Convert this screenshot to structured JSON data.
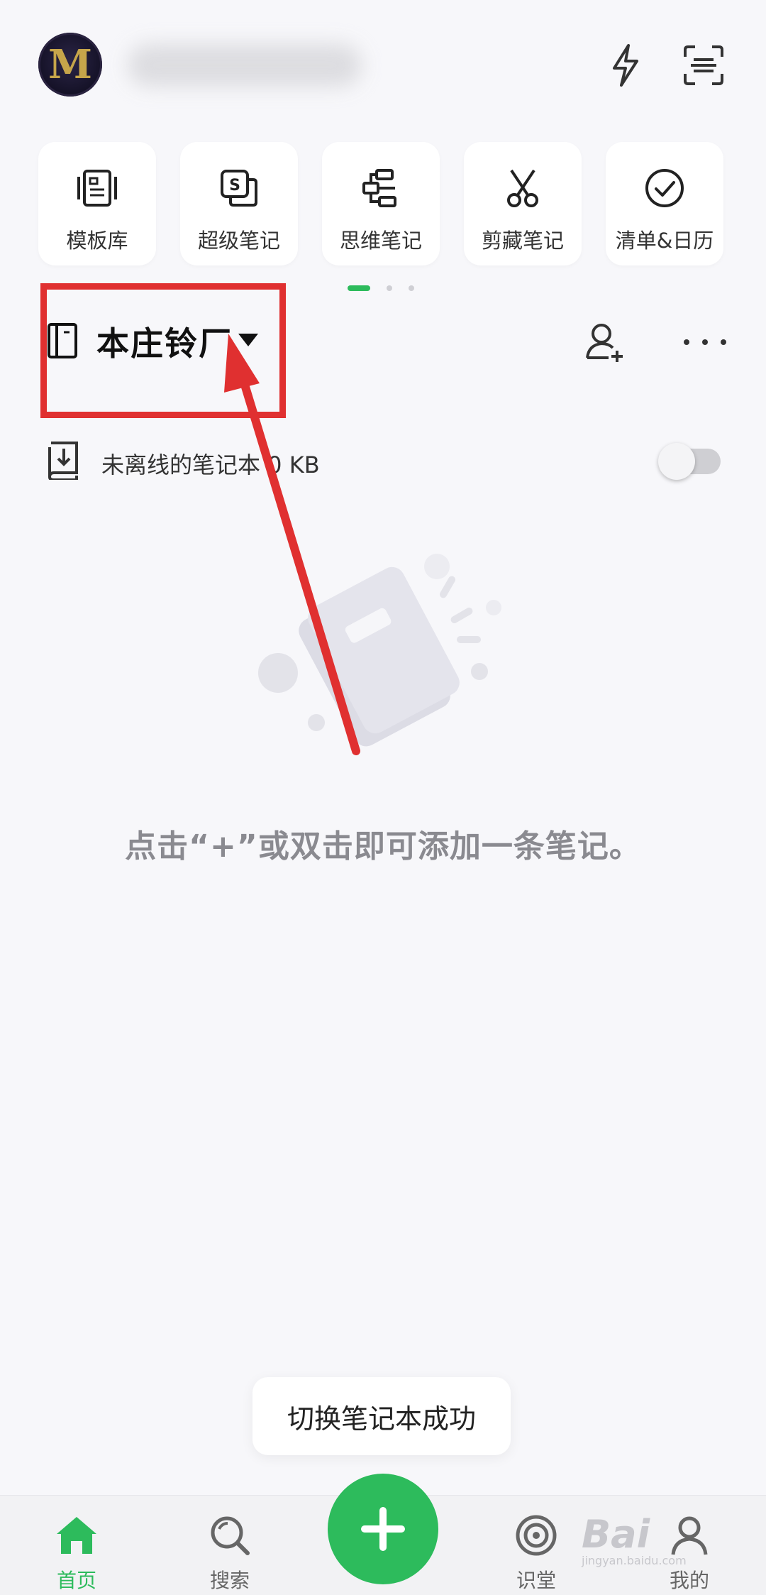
{
  "header": {
    "avatar_letter": "M"
  },
  "tools": [
    {
      "label": "模板库",
      "icon": "template-icon"
    },
    {
      "label": "超级笔记",
      "icon": "super-note-icon"
    },
    {
      "label": "思维笔记",
      "icon": "mind-map-icon"
    },
    {
      "label": "剪藏笔记",
      "icon": "scissors-icon"
    },
    {
      "label": "清单&日历",
      "icon": "checklist-icon"
    }
  ],
  "pager": {
    "pages": 3,
    "active": 0
  },
  "notebook": {
    "title": "本庄铃厂"
  },
  "offline": {
    "text": "未离线的笔记本 0 KB",
    "enabled": false
  },
  "empty_state": {
    "message": "点击“+”或双击即可添加一条笔记。"
  },
  "toast": {
    "text": "切换笔记本成功"
  },
  "bottom_nav": [
    {
      "label": "首页",
      "icon": "home-icon",
      "active": true
    },
    {
      "label": "搜索",
      "icon": "search-icon",
      "active": false
    },
    {
      "label": "识堂",
      "icon": "learn-icon",
      "active": false
    },
    {
      "label": "我的",
      "icon": "profile-icon",
      "active": false
    }
  ],
  "watermark": {
    "text": "Bai",
    "sub": "jingyan.baidu.com"
  },
  "colors": {
    "accent": "#2dbb5c",
    "annotation": "#e03030",
    "background": "#f7f7fa"
  }
}
